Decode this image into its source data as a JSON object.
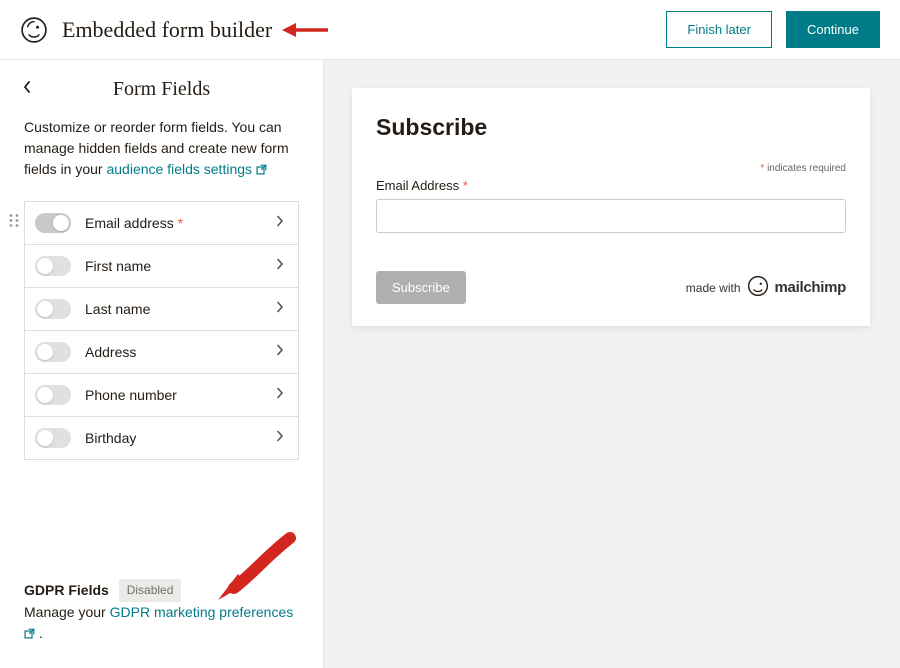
{
  "header": {
    "title": "Embedded form builder",
    "finish_later": "Finish later",
    "continue": "Continue"
  },
  "sidebar": {
    "title": "Form Fields",
    "desc_a": "Customize or reorder form fields. You can manage hidden fields and create new form fields in your ",
    "desc_link": "audience fields settings",
    "fields": [
      {
        "label": "Email address",
        "required": true,
        "on": true
      },
      {
        "label": "First name",
        "required": false,
        "on": false
      },
      {
        "label": "Last name",
        "required": false,
        "on": false
      },
      {
        "label": "Address",
        "required": false,
        "on": false
      },
      {
        "label": "Phone number",
        "required": false,
        "on": false
      },
      {
        "label": "Birthday",
        "required": false,
        "on": false
      }
    ]
  },
  "gdpr": {
    "title": "GDPR Fields",
    "badge": "Disabled",
    "desc_a": "Manage your ",
    "link": "GDPR marketing preferences",
    "desc_b": " ."
  },
  "preview": {
    "title": "Subscribe",
    "indicates": "indicates required",
    "email_label": "Email Address",
    "email_placeholder": "",
    "subscribe_btn": "Subscribe",
    "made_with": "made with",
    "brand": "mailchimp"
  }
}
